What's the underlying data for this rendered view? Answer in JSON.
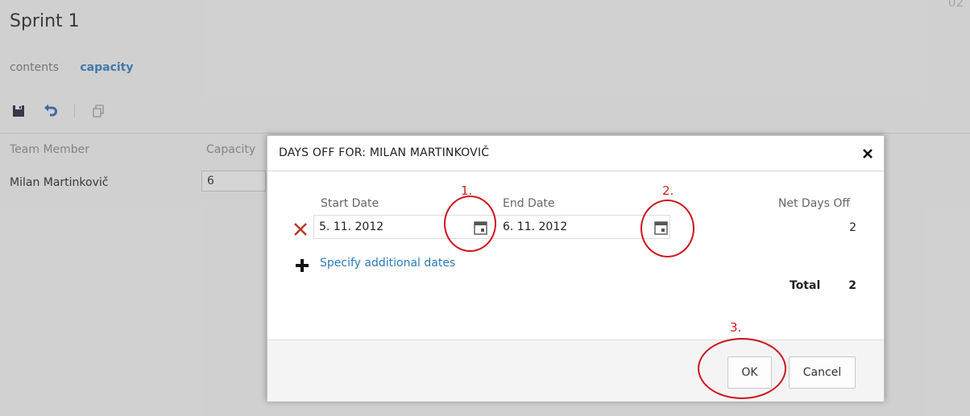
{
  "page": {
    "title": "Sprint 1",
    "corner_text": "02",
    "tabs": [
      {
        "label": "contents"
      },
      {
        "label": "capacity"
      }
    ],
    "table": {
      "columns": [
        "Team Member",
        "Capacity"
      ],
      "rows": [
        {
          "member": "Milan Martinkovič",
          "capacity": "6"
        }
      ]
    }
  },
  "dialog": {
    "title": "DAYS OFF FOR: MILAN MARTINKOVIČ",
    "start_label": "Start Date",
    "end_label": "End Date",
    "net_label": "Net Days Off",
    "start_value": "5. 11. 2012",
    "end_value": "6. 11. 2012",
    "net_value": "2",
    "add_link": "Specify additional dates",
    "total_label": "Total",
    "total_value": "2",
    "ok_label": "OK",
    "cancel_label": "Cancel"
  },
  "annotations": [
    "1.",
    "2.",
    "3."
  ],
  "icons": {
    "save": "save-icon",
    "undo": "undo-icon",
    "copy": "copy-icon",
    "close": "close-icon",
    "delete": "delete-icon",
    "add": "plus-icon",
    "calendar": "calendar-icon"
  },
  "colors": {
    "accent": "#2b7bbd",
    "annotation": "#d0141c",
    "delete": "#b83a2a"
  }
}
